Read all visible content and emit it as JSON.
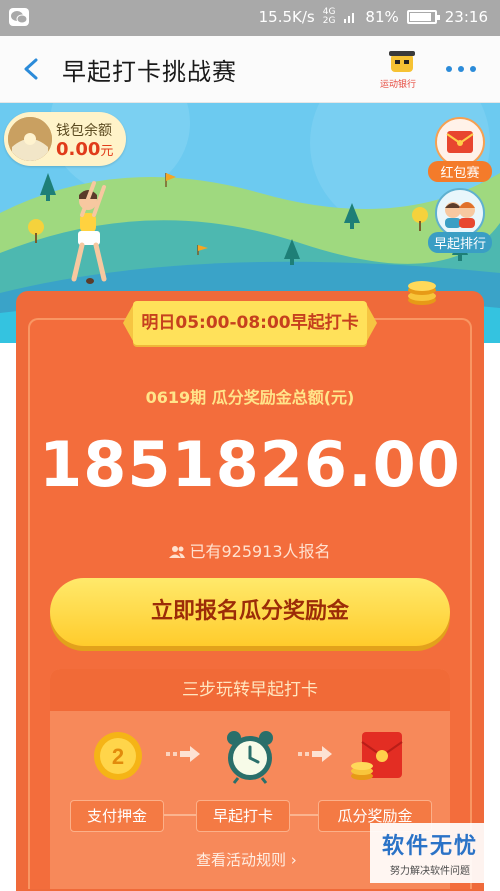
{
  "status_bar": {
    "network_speed": "15.5K/s",
    "network_type_top": "4G",
    "network_type_bottom": "2G",
    "battery": "81%",
    "time": "23:16"
  },
  "nav": {
    "title": "早起打卡挑战赛",
    "sport_badge": "运动银行"
  },
  "wallet": {
    "label": "钱包余额",
    "amount": "0.00",
    "unit": "元"
  },
  "side_buttons": {
    "red_packet": "红包赛",
    "ranking": "早起排行"
  },
  "card": {
    "schedule": "明日05:00-08:00早起打卡",
    "period_label": "0619期 瓜分奖励金总额(元)",
    "prize_total": "1851826.00",
    "joined_text": "已有925913人报名",
    "cta_label": "立即报名瓜分奖励金"
  },
  "steps": {
    "title": "三步玩转早起打卡",
    "items": [
      {
        "label": "支付押金",
        "icon": "coin-icon"
      },
      {
        "label": "早起打卡",
        "icon": "alarm-clock-icon"
      },
      {
        "label": "瓜分奖励金",
        "icon": "red-envelope-icon"
      }
    ],
    "rules_link": "查看活动规则 ›"
  },
  "watermark": {
    "title": "软件无忧",
    "subtitle": "努力解决软件问题"
  },
  "colors": {
    "orange": "#ef6a3a",
    "yellow": "#ffe15a",
    "sky": "#5ec0ea"
  }
}
